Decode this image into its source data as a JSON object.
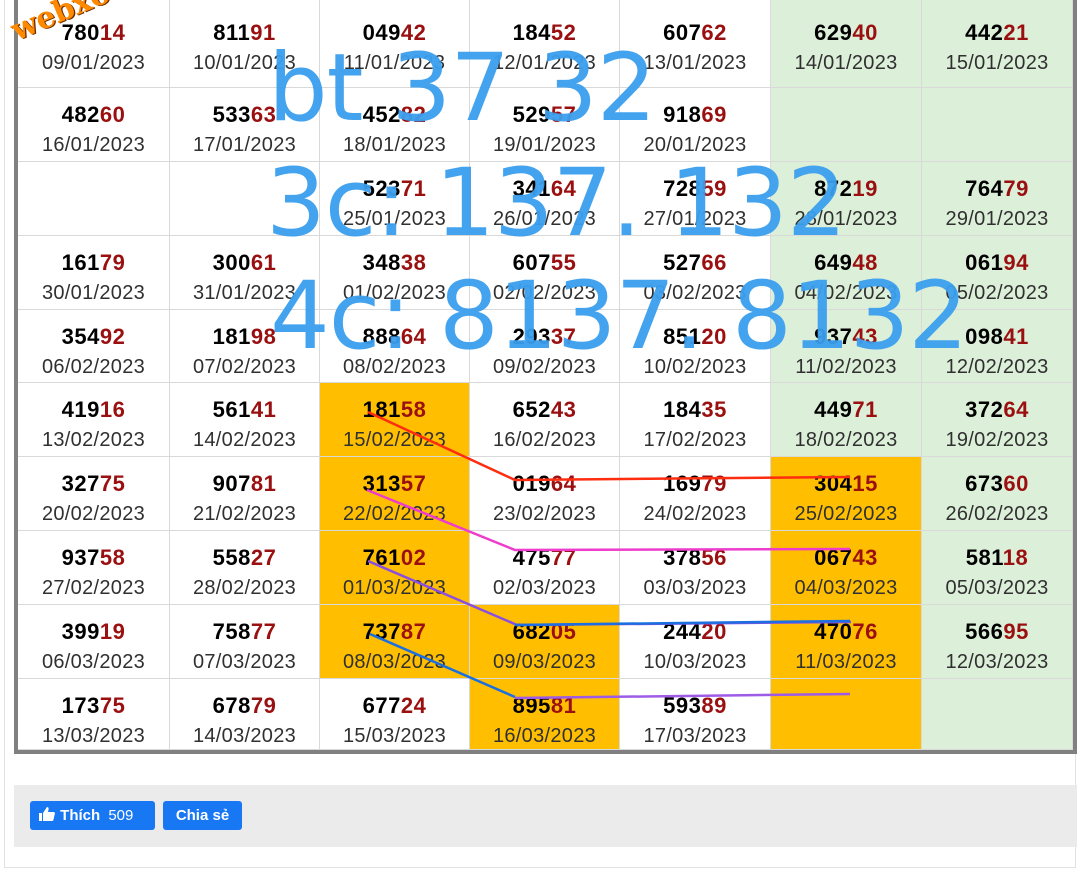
{
  "watermark": "webxoso.net",
  "annotations": [
    "bt 37 32",
    "3c: 137. 132",
    "4c: 8137. 8132"
  ],
  "footer": {
    "like_label": "Thích",
    "like_count": "509",
    "share_label": "Chia sẻ"
  },
  "colors": {
    "highlight": "#ffbf00",
    "weekend": "#dcefd9",
    "tail_digits": "#9a1010",
    "annotation": "#3b9fee"
  },
  "rows": [
    [
      {
        "head": "780",
        "tail": "14",
        "date": "09/01/2023",
        "bg": "w"
      },
      {
        "head": "811",
        "tail": "91",
        "date": "10/01/2023",
        "bg": "w"
      },
      {
        "head": "049",
        "tail": "42",
        "date": "11/01/2023",
        "bg": "w"
      },
      {
        "head": "184",
        "tail": "52",
        "date": "12/01/2023",
        "bg": "w"
      },
      {
        "head": "607",
        "tail": "62",
        "date": "13/01/2023",
        "bg": "w"
      },
      {
        "head": "629",
        "tail": "40",
        "date": "14/01/2023",
        "bg": "g"
      },
      {
        "head": "442",
        "tail": "21",
        "date": "15/01/2023",
        "bg": "g"
      }
    ],
    [
      {
        "head": "482",
        "tail": "60",
        "date": "16/01/2023",
        "bg": "w"
      },
      {
        "head": "533",
        "tail": "63",
        "date": "17/01/2023",
        "bg": "w"
      },
      {
        "head": "452",
        "tail": "82",
        "date": "18/01/2023",
        "bg": "w"
      },
      {
        "head": "529",
        "tail": "57",
        "date": "19/01/2023",
        "bg": "w"
      },
      {
        "head": "918",
        "tail": "69",
        "date": "20/01/2023",
        "bg": "w"
      },
      {
        "head": "",
        "tail": "",
        "date": "",
        "bg": "g"
      },
      {
        "head": "",
        "tail": "",
        "date": "",
        "bg": "g"
      }
    ],
    [
      {
        "head": "",
        "tail": "",
        "date": "",
        "bg": "w"
      },
      {
        "head": "",
        "tail": "",
        "date": "",
        "bg": "w"
      },
      {
        "head": "523",
        "tail": "71",
        "date": "25/01/2023",
        "bg": "w"
      },
      {
        "head": "341",
        "tail": "64",
        "date": "26/01/2023",
        "bg": "w"
      },
      {
        "head": "728",
        "tail": "59",
        "date": "27/01/2023",
        "bg": "w"
      },
      {
        "head": "872",
        "tail": "19",
        "date": "28/01/2023",
        "bg": "g"
      },
      {
        "head": "764",
        "tail": "79",
        "date": "29/01/2023",
        "bg": "g"
      }
    ],
    [
      {
        "head": "161",
        "tail": "79",
        "date": "30/01/2023",
        "bg": "w"
      },
      {
        "head": "300",
        "tail": "61",
        "date": "31/01/2023",
        "bg": "w"
      },
      {
        "head": "348",
        "tail": "38",
        "date": "01/02/2023",
        "bg": "w"
      },
      {
        "head": "607",
        "tail": "55",
        "date": "02/02/2023",
        "bg": "w"
      },
      {
        "head": "527",
        "tail": "66",
        "date": "03/02/2023",
        "bg": "w"
      },
      {
        "head": "649",
        "tail": "48",
        "date": "04/02/2023",
        "bg": "g"
      },
      {
        "head": "061",
        "tail": "94",
        "date": "05/02/2023",
        "bg": "g"
      }
    ],
    [
      {
        "head": "354",
        "tail": "92",
        "date": "06/02/2023",
        "bg": "w"
      },
      {
        "head": "181",
        "tail": "98",
        "date": "07/02/2023",
        "bg": "w"
      },
      {
        "head": "888",
        "tail": "64",
        "date": "08/02/2023",
        "bg": "w"
      },
      {
        "head": "293",
        "tail": "37",
        "date": "09/02/2023",
        "bg": "w"
      },
      {
        "head": "851",
        "tail": "20",
        "date": "10/02/2023",
        "bg": "w"
      },
      {
        "head": "937",
        "tail": "43",
        "date": "11/02/2023",
        "bg": "g"
      },
      {
        "head": "098",
        "tail": "41",
        "date": "12/02/2023",
        "bg": "g"
      }
    ],
    [
      {
        "head": "419",
        "tail": "16",
        "date": "13/02/2023",
        "bg": "w"
      },
      {
        "head": "561",
        "tail": "41",
        "date": "14/02/2023",
        "bg": "w"
      },
      {
        "head": "181",
        "tail": "58",
        "date": "15/02/2023",
        "bg": "o"
      },
      {
        "head": "652",
        "tail": "43",
        "date": "16/02/2023",
        "bg": "w"
      },
      {
        "head": "184",
        "tail": "35",
        "date": "17/02/2023",
        "bg": "w"
      },
      {
        "head": "449",
        "tail": "71",
        "date": "18/02/2023",
        "bg": "g"
      },
      {
        "head": "372",
        "tail": "64",
        "date": "19/02/2023",
        "bg": "g"
      }
    ],
    [
      {
        "head": "327",
        "tail": "75",
        "date": "20/02/2023",
        "bg": "w"
      },
      {
        "head": "907",
        "tail": "81",
        "date": "21/02/2023",
        "bg": "w"
      },
      {
        "head": "313",
        "tail": "57",
        "date": "22/02/2023",
        "bg": "o"
      },
      {
        "head": "019",
        "tail": "64",
        "date": "23/02/2023",
        "bg": "w"
      },
      {
        "head": "169",
        "tail": "79",
        "date": "24/02/2023",
        "bg": "w"
      },
      {
        "head": "304",
        "tail": "15",
        "date": "25/02/2023",
        "bg": "o"
      },
      {
        "head": "673",
        "tail": "60",
        "date": "26/02/2023",
        "bg": "g"
      }
    ],
    [
      {
        "head": "937",
        "tail": "58",
        "date": "27/02/2023",
        "bg": "w"
      },
      {
        "head": "558",
        "tail": "27",
        "date": "28/02/2023",
        "bg": "w"
      },
      {
        "head": "761",
        "tail": "02",
        "date": "01/03/2023",
        "bg": "o"
      },
      {
        "head": "475",
        "tail": "77",
        "date": "02/03/2023",
        "bg": "w"
      },
      {
        "head": "378",
        "tail": "56",
        "date": "03/03/2023",
        "bg": "w"
      },
      {
        "head": "067",
        "tail": "43",
        "date": "04/03/2023",
        "bg": "o"
      },
      {
        "head": "581",
        "tail": "18",
        "date": "05/03/2023",
        "bg": "g"
      }
    ],
    [
      {
        "head": "399",
        "tail": "19",
        "date": "06/03/2023",
        "bg": "w"
      },
      {
        "head": "758",
        "tail": "77",
        "date": "07/03/2023",
        "bg": "w"
      },
      {
        "head": "737",
        "tail": "87",
        "date": "08/03/2023",
        "bg": "o"
      },
      {
        "head": "682",
        "tail": "05",
        "date": "09/03/2023",
        "bg": "o"
      },
      {
        "head": "244",
        "tail": "20",
        "date": "10/03/2023",
        "bg": "w"
      },
      {
        "head": "470",
        "tail": "76",
        "date": "11/03/2023",
        "bg": "o"
      },
      {
        "head": "566",
        "tail": "95",
        "date": "12/03/2023",
        "bg": "g"
      }
    ],
    [
      {
        "head": "173",
        "tail": "75",
        "date": "13/03/2023",
        "bg": "w"
      },
      {
        "head": "678",
        "tail": "79",
        "date": "14/03/2023",
        "bg": "w"
      },
      {
        "head": "677",
        "tail": "24",
        "date": "15/03/2023",
        "bg": "w"
      },
      {
        "head": "895",
        "tail": "81",
        "date": "16/03/2023",
        "bg": "o"
      },
      {
        "head": "593",
        "tail": "89",
        "date": "17/03/2023",
        "bg": "w"
      },
      {
        "head": "",
        "tail": "",
        "date": "",
        "bg": "o"
      },
      {
        "head": "",
        "tail": "",
        "date": "",
        "bg": "g"
      }
    ]
  ]
}
